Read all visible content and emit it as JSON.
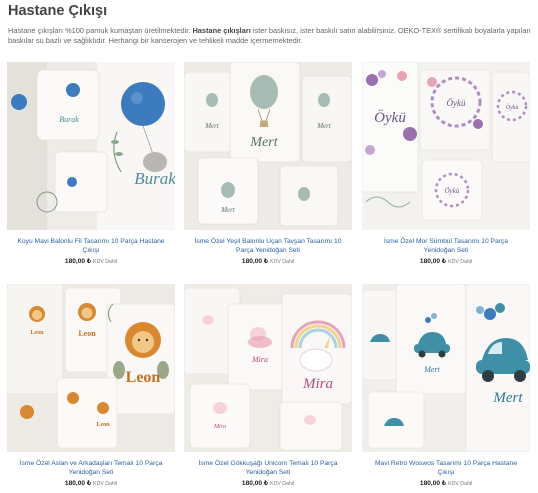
{
  "heading": "Hastane Çıkışı",
  "description": {
    "p1": "Hastane çıkışları %100 pamuk kumaştan üretilmektedir. ",
    "p1_bold": "Hastane çıkışları",
    "p2": " ister baskısız, ister baskılı satın alabilirsiniz. OEKO-TEX® sertifikalı boyalarla yapılan baskılar su bazlı ve sağlıklıdır. Herhangi bir kanserojen ve tehlikeli madde içermemektedir."
  },
  "products": [
    {
      "title": "Koyu Mavi Balonlu Fil Tasarımı 10 Parça Hastane Çıkışı",
      "price": "180,00 ₺",
      "tax": "KDV Dahil",
      "image_text": "Burak"
    },
    {
      "title": "İsme Özel Yeşil Balonlu Uçan Tavşan Tasarımı 10 Parça Yenidoğan Seti",
      "price": "180,00 ₺",
      "tax": "KDV Dahil",
      "image_text": "Mert"
    },
    {
      "title": "İsme Özel Mor Sümbül Tasarımı 10 Parça Yenidoğan Seti",
      "price": "180,00 ₺",
      "tax": "KDV Dahil",
      "image_text": "Öykü"
    },
    {
      "title": "İsme Özel Aslan ve Arkadaşları Temalı 10 Parça Yenidoğan Seti",
      "price": "180,00 ₺",
      "tax": "KDV Dahil",
      "image_text": "Leon"
    },
    {
      "title": "İsme Özel Gökkuşağı Unicorn Temalı 10 Parça Yenidoğan Seti",
      "price": "180,00 ₺",
      "tax": "KDV Dahil",
      "image_text": "Mira"
    },
    {
      "title": "Mavi Retro Woswos Tasarımı 10 Parça Hastane Çıkışı",
      "price": "180,00 ₺",
      "tax": "KDV Dahil",
      "image_text": "Mert"
    }
  ],
  "colors": {
    "link": "#2b5fa0",
    "accent_blue": "#3d7bbf",
    "sage": "#8aa39a",
    "lilac": "#9b6fb0",
    "orange": "#d9882f",
    "pink": "#e9a3b8",
    "teal": "#3f8fa6"
  }
}
